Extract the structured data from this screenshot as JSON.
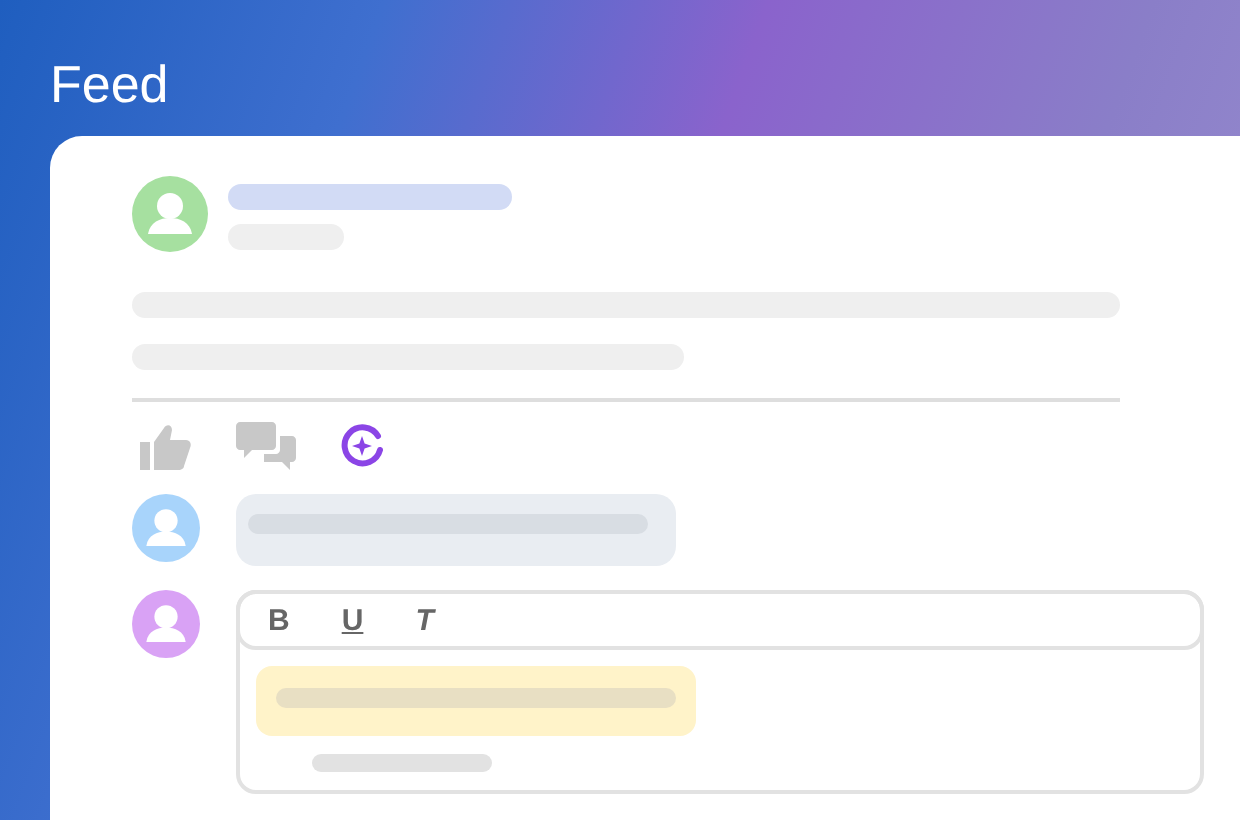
{
  "title": "Feed",
  "format_buttons": [
    {
      "label": "B",
      "kind": "bold"
    },
    {
      "label": "U",
      "kind": "underline"
    },
    {
      "label": "T",
      "kind": "italic"
    }
  ]
}
